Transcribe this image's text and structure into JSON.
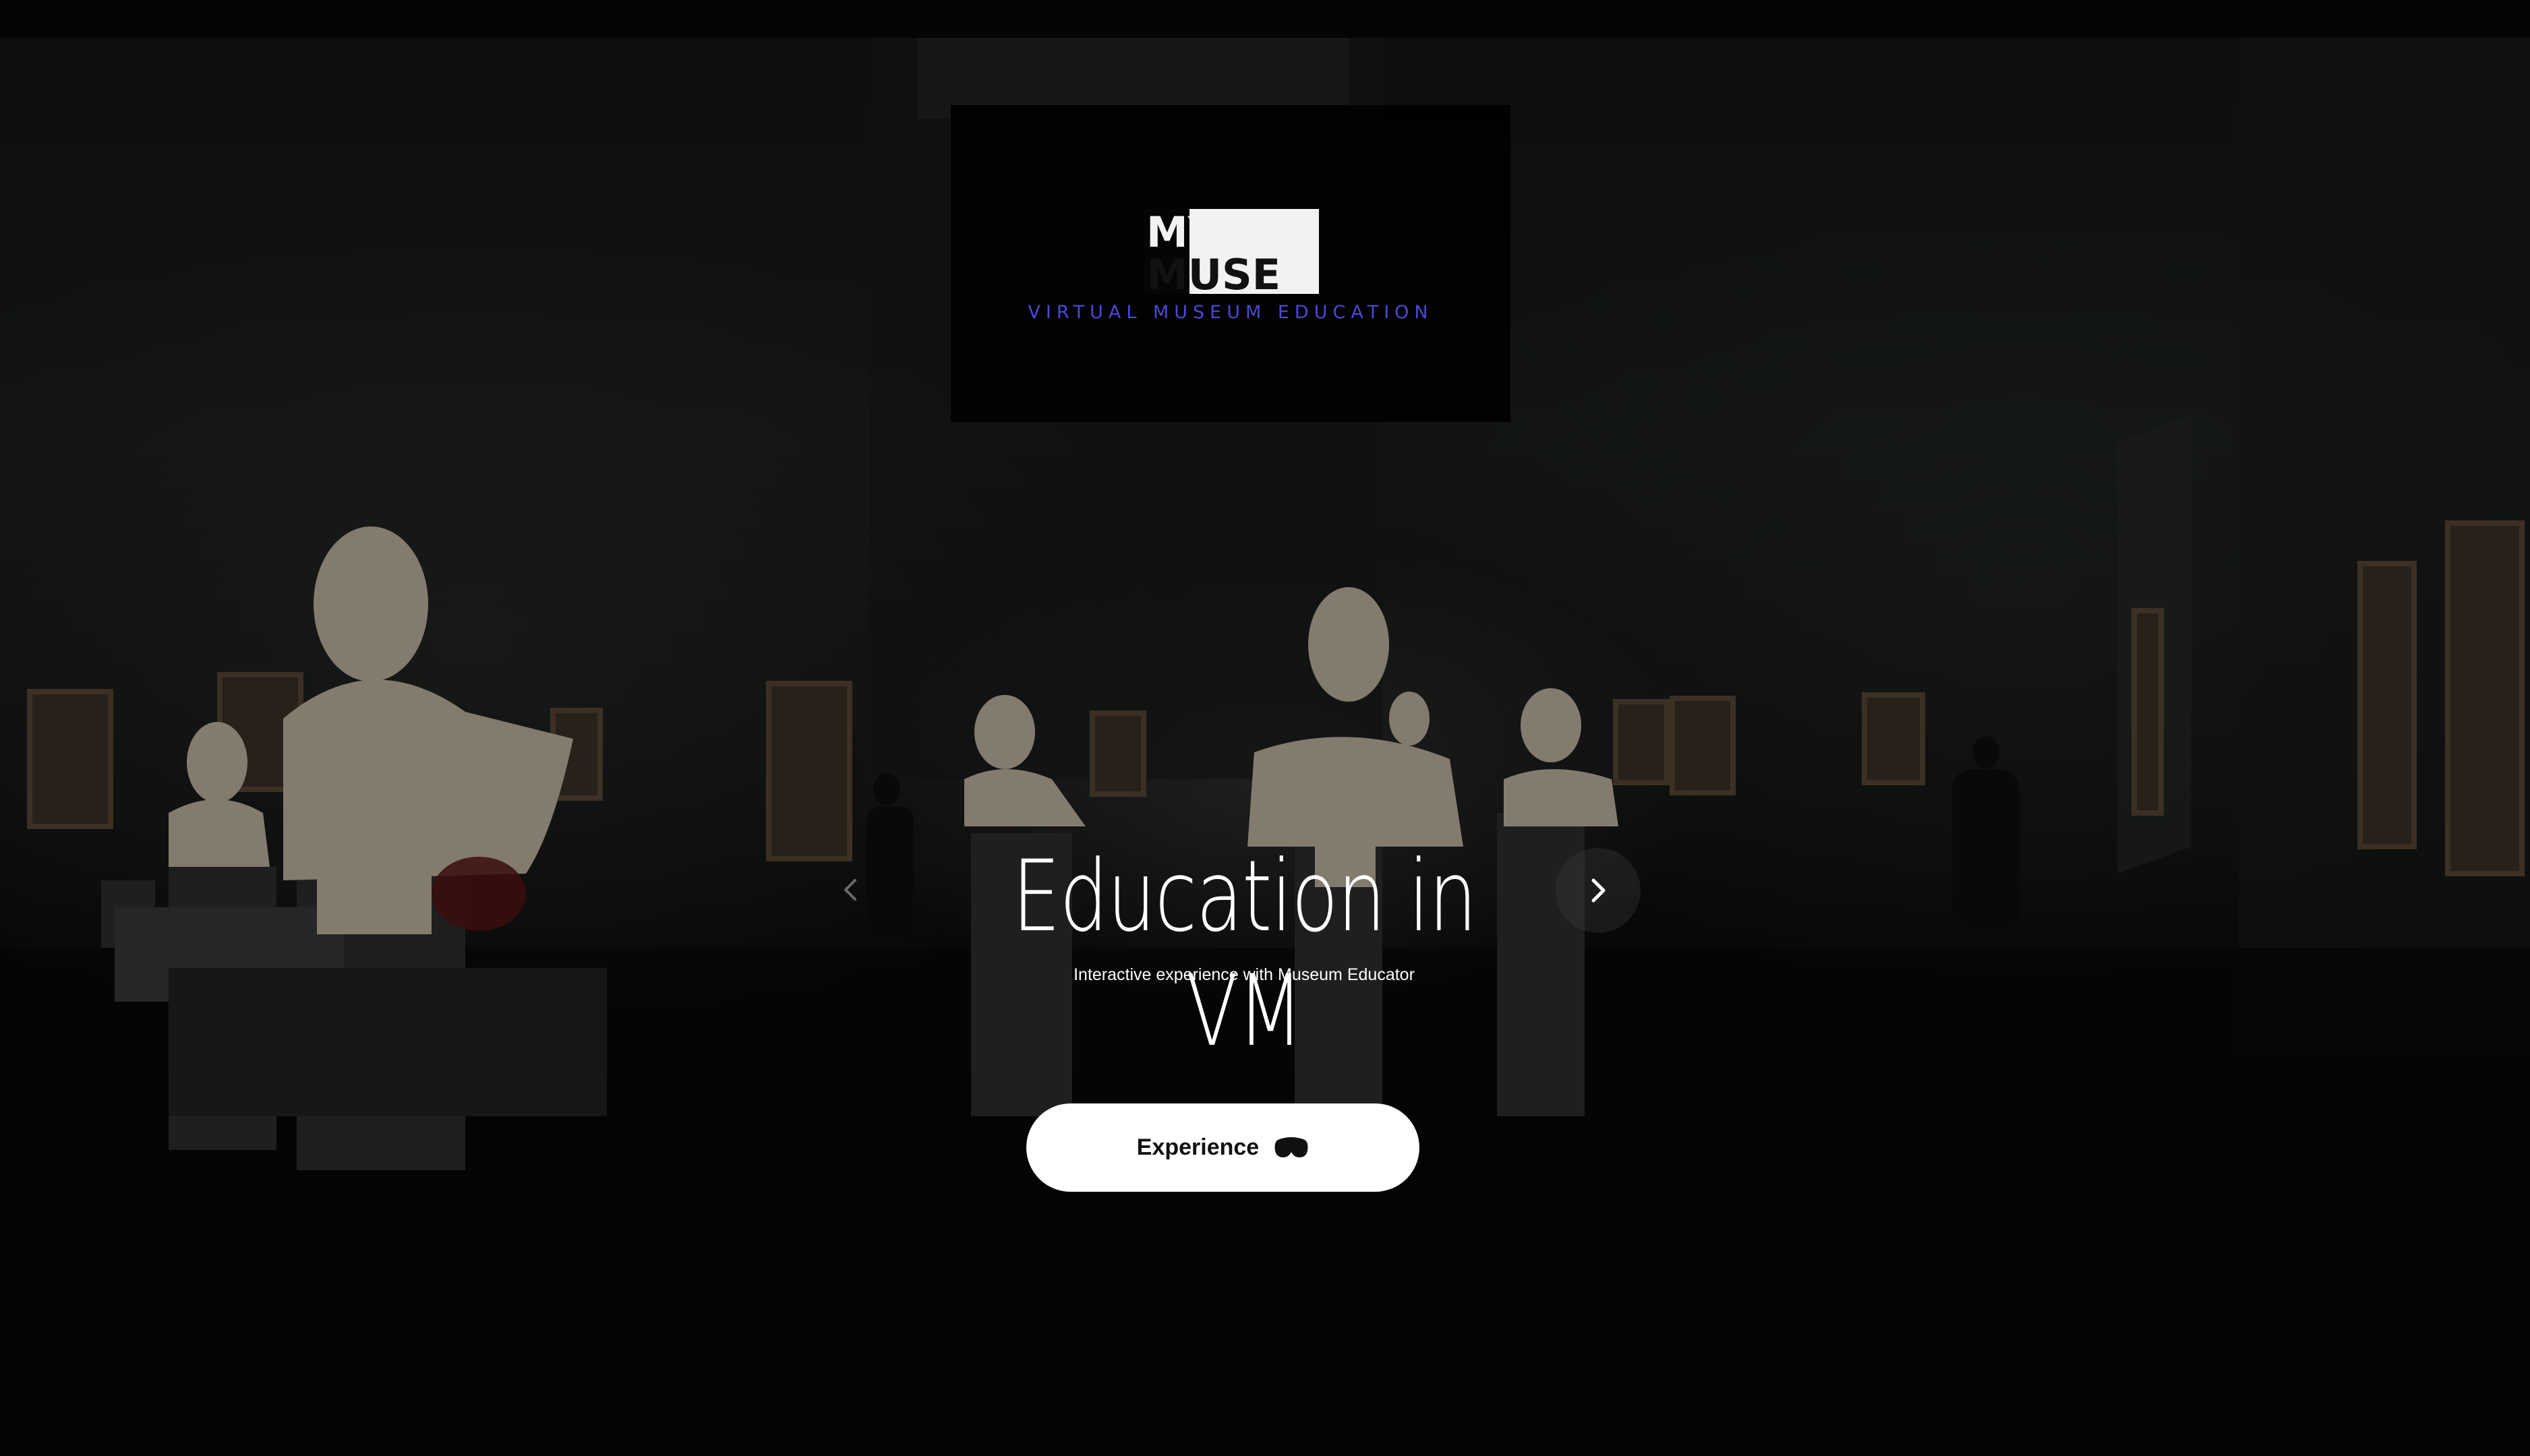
{
  "logo": {
    "line1": "MY",
    "line2": "MUSE",
    "tagline": "VIRTUAL MUSEUM EDUCATION",
    "accent_color": "#4a49d4"
  },
  "hero": {
    "title": "Education in VM",
    "subtitle": "Interactive experience with Museum Educator"
  },
  "carousel": {
    "prev_icon": "chevron-left-icon",
    "next_icon": "chevron-right-icon"
  },
  "cta": {
    "label": "Experience",
    "icon": "vr-headset-icon"
  }
}
